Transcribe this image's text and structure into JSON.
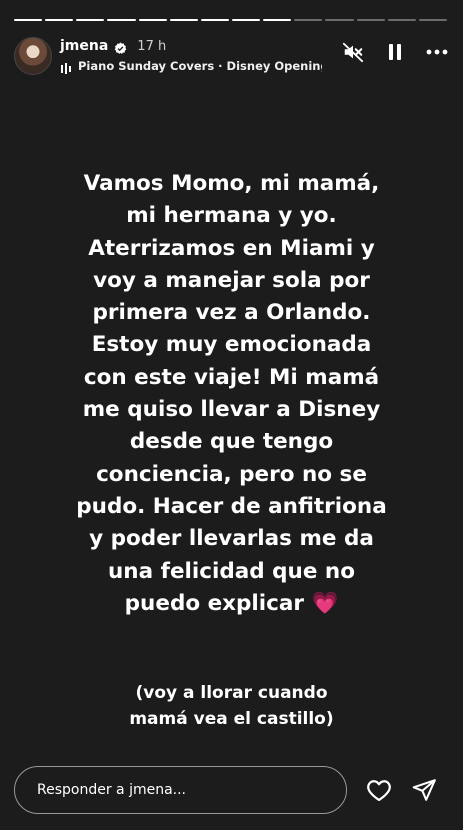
{
  "progress": {
    "total_segments": 14,
    "completed_segments": 9
  },
  "header": {
    "username": "jmena",
    "timestamp": "17 h",
    "music_text": "Piano Sunday Covers · Disney Opening T"
  },
  "story": {
    "caption": "Vamos Momo, mi mamá,\nmi hermana y yo.\nAterrizamos en Miami y\nvoy a manejar sola por\nprimera vez a Orlando.\nEstoy muy emocionada\ncon este viaje! Mi mamá\nme quiso llevar a Disney\ndesde que tengo\nconciencia, pero no se\npudo. Hacer de anfitriona\ny poder llevarlas me da\nuna felicidad que no\npuedo explicar",
    "caption_emoji": "💗",
    "note": "(voy a llorar cuando\nmamá vea el castillo)"
  },
  "reply": {
    "placeholder": "Responder a jmena..."
  },
  "icons": [
    "verified-badge-icon",
    "music-note-icon",
    "mute-icon",
    "pause-icon",
    "more-options-icon",
    "heart-icon",
    "send-icon"
  ],
  "colors": {
    "background": "#1c1c1d",
    "text": "#ffffff",
    "heart_emoji": "#ff3fae"
  }
}
